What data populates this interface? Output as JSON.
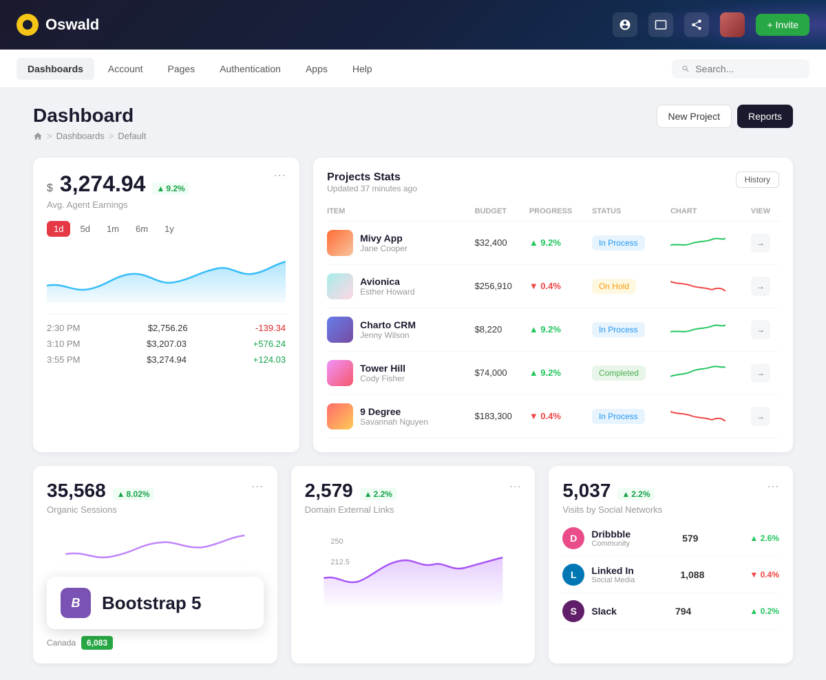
{
  "topbar": {
    "logo_text": "Oswald",
    "invite_label": "+ Invite"
  },
  "navbar": {
    "items": [
      {
        "label": "Dashboards",
        "active": true
      },
      {
        "label": "Account",
        "active": false
      },
      {
        "label": "Pages",
        "active": false
      },
      {
        "label": "Authentication",
        "active": false
      },
      {
        "label": "Apps",
        "active": false
      },
      {
        "label": "Help",
        "active": false
      }
    ],
    "search_placeholder": "Search..."
  },
  "page_header": {
    "title": "Dashboard",
    "breadcrumb": [
      "Home",
      "Dashboards",
      "Default"
    ],
    "btn_new_project": "New Project",
    "btn_reports": "Reports"
  },
  "earnings_card": {
    "currency": "$",
    "amount": "3,274.94",
    "change": "9.2%",
    "change_direction": "up",
    "subtitle": "Avg. Agent Earnings",
    "time_filters": [
      "1d",
      "5d",
      "1m",
      "6m",
      "1y"
    ],
    "active_filter": "1d",
    "more_icon": "⋯",
    "rows": [
      {
        "time": "2:30 PM",
        "value": "$2,756.26",
        "change": "-139.34",
        "direction": "neg"
      },
      {
        "time": "3:10 PM",
        "value": "$3,207.03",
        "change": "+576.24",
        "direction": "pos"
      },
      {
        "time": "3:55 PM",
        "value": "$3,274.94",
        "change": "+124.03",
        "direction": "pos"
      }
    ]
  },
  "projects_card": {
    "title": "Projects Stats",
    "subtitle": "Updated 37 minutes ago",
    "history_label": "History",
    "columns": [
      "ITEM",
      "BUDGET",
      "PROGRESS",
      "STATUS",
      "CHART",
      "VIEW"
    ],
    "projects": [
      {
        "name": "Mivy App",
        "person": "Jane Cooper",
        "budget": "$32,400",
        "progress": "9.2%",
        "progress_dir": "up",
        "status": "In Process",
        "status_class": "status-inprocess",
        "icon_bg": "linear-gradient(135deg,#ff6b35,#f7c59f)"
      },
      {
        "name": "Avionica",
        "person": "Esther Howard",
        "budget": "$256,910",
        "progress": "0.4%",
        "progress_dir": "down",
        "status": "On Hold",
        "status_class": "status-onhold",
        "icon_bg": "linear-gradient(135deg,#a8edea,#fed6e3)"
      },
      {
        "name": "Charto CRM",
        "person": "Jenny Wilson",
        "budget": "$8,220",
        "progress": "9.2%",
        "progress_dir": "up",
        "status": "In Process",
        "status_class": "status-inprocess",
        "icon_bg": "linear-gradient(135deg,#667eea,#764ba2)"
      },
      {
        "name": "Tower Hill",
        "person": "Cody Fisher",
        "budget": "$74,000",
        "progress": "9.2%",
        "progress_dir": "up",
        "status": "Completed",
        "status_class": "status-completed",
        "icon_bg": "linear-gradient(135deg,#f093fb,#f5576c)"
      },
      {
        "name": "9 Degree",
        "person": "Savannah Nguyen",
        "budget": "$183,300",
        "progress": "0.4%",
        "progress_dir": "down",
        "status": "In Process",
        "status_class": "status-inprocess",
        "icon_bg": "linear-gradient(135deg,#ff6b6b,#feca57)"
      }
    ]
  },
  "organic_sessions": {
    "value": "35,568",
    "change": "8.02%",
    "change_dir": "up",
    "label": "Organic Sessions"
  },
  "domain_links": {
    "value": "2,579",
    "change": "2.2%",
    "change_dir": "up",
    "label": "Domain External Links"
  },
  "social_networks": {
    "value": "5,037",
    "change": "2.2%",
    "change_dir": "up",
    "label": "Visits by Social Networks",
    "networks": [
      {
        "name": "Dribbble",
        "type": "Community",
        "count": "579",
        "change": "2.6%",
        "dir": "up",
        "color": "#ea4c89"
      },
      {
        "name": "Linked In",
        "type": "Social Media",
        "count": "1,088",
        "change": "0.4%",
        "dir": "down",
        "color": "#0077b5"
      },
      {
        "name": "Slack",
        "type": "",
        "count": "794",
        "change": "0.2%",
        "dir": "up",
        "color": "#611f69"
      }
    ]
  },
  "map_card": {
    "canada_label": "Canada",
    "canada_value": "6,083"
  },
  "bootstrap": {
    "icon": "B",
    "label": "Bootstrap 5"
  }
}
